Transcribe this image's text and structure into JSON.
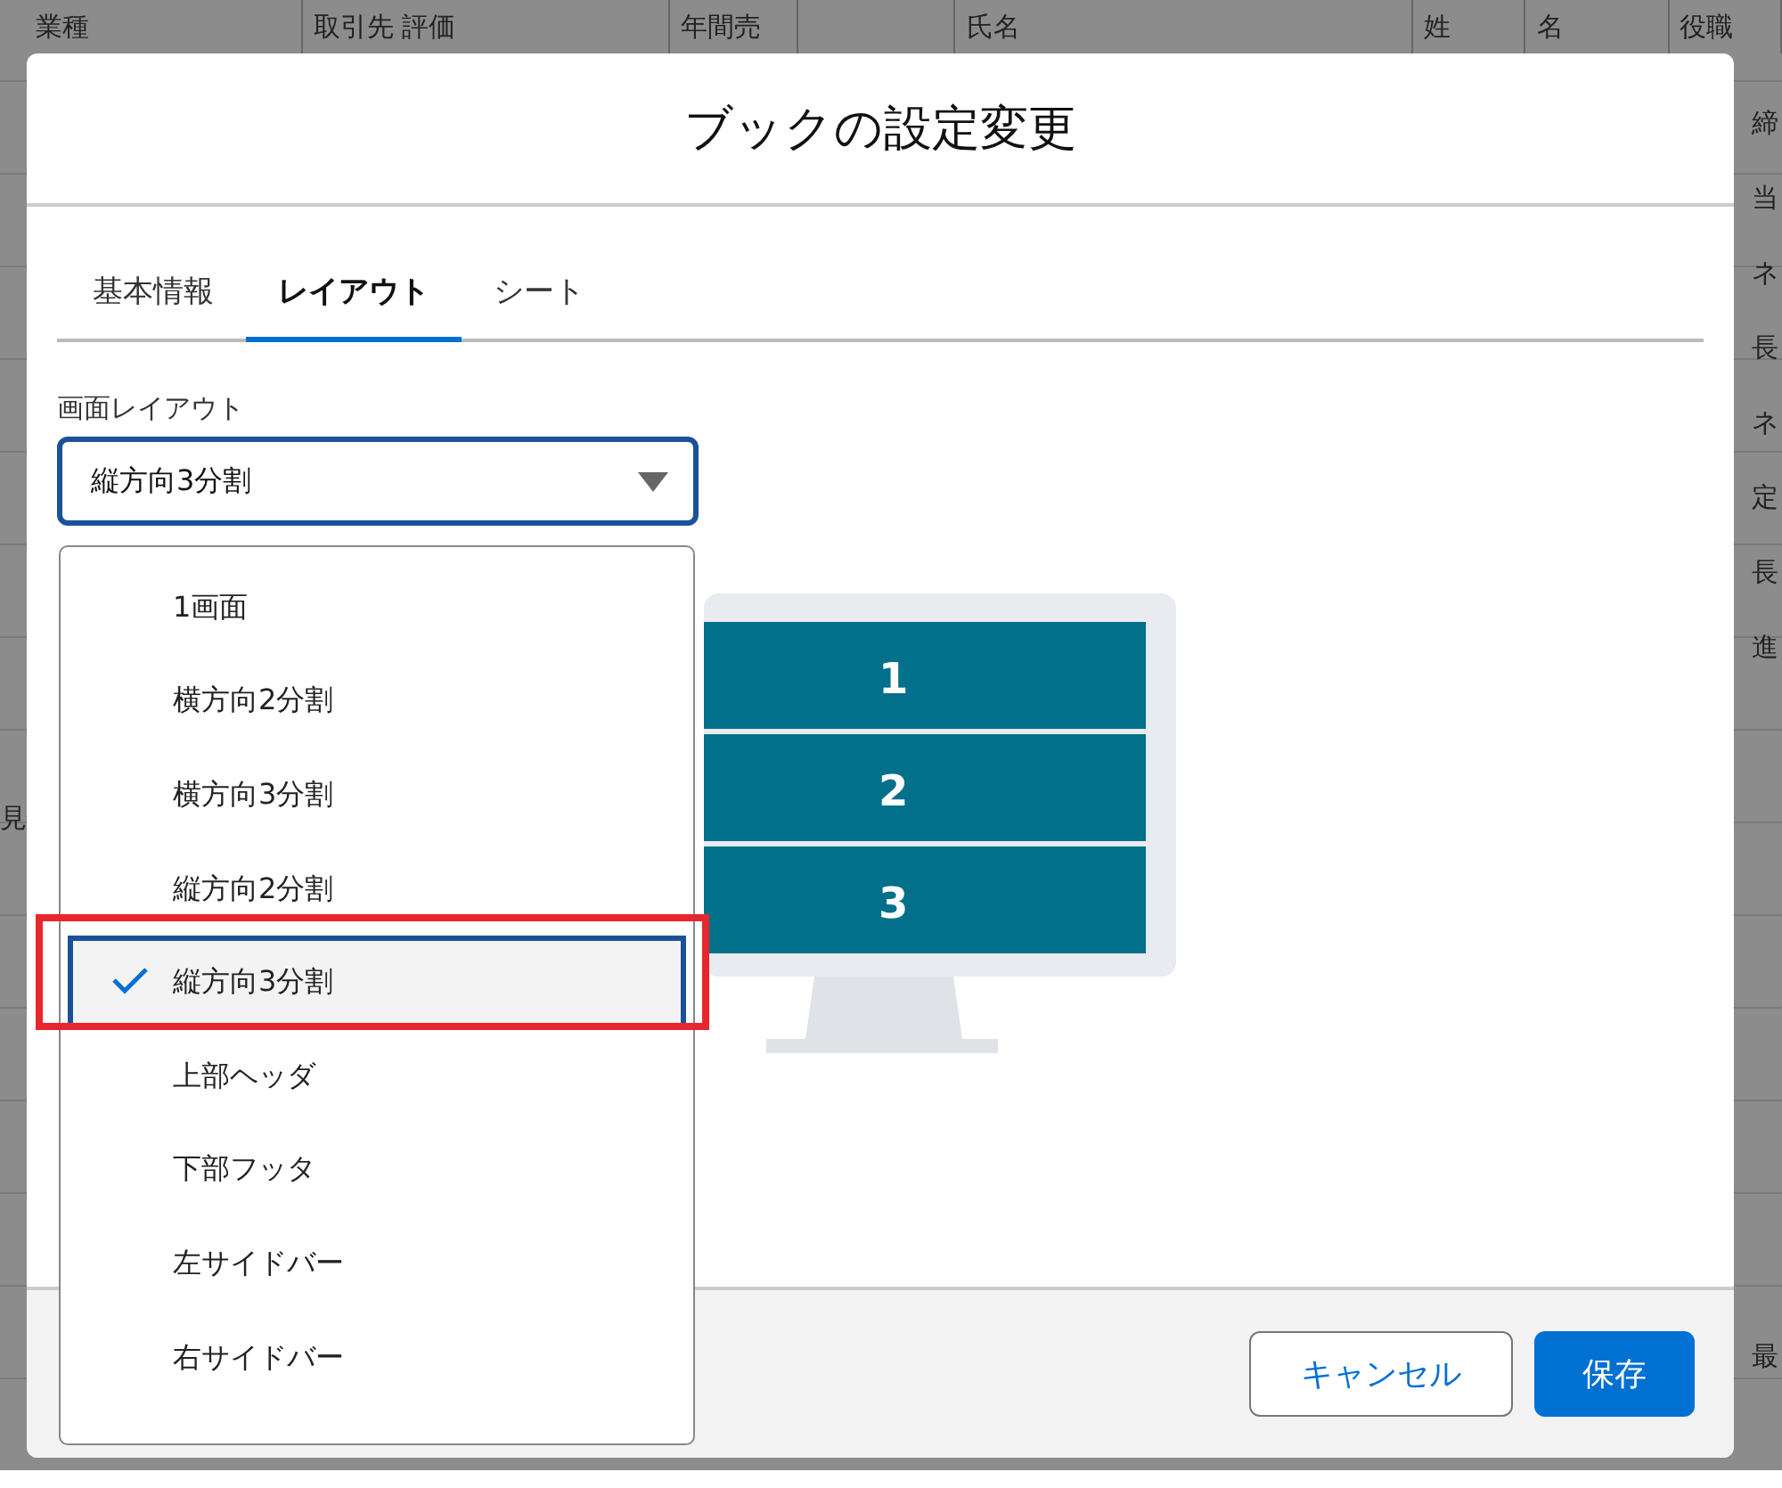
{
  "background_sheet": {
    "columns": [
      "業種",
      "取引先 評価",
      "年間売",
      "",
      "氏名",
      "姓",
      "名",
      "役職"
    ],
    "right_fragments": [
      "締",
      "当",
      "ネ",
      "長",
      "ネ",
      "定",
      "長",
      "進"
    ],
    "left_fragment": "見",
    "right_bottom": "最"
  },
  "dialog": {
    "title": "ブックの設定変更",
    "tabs": [
      {
        "label": "基本情報",
        "selected": false
      },
      {
        "label": "レイアウト",
        "selected": true
      },
      {
        "label": "シート",
        "selected": false
      }
    ],
    "layout_field": {
      "label": "画面レイアウト",
      "value": "縦方向3分割",
      "options": [
        {
          "label": "1画面",
          "selected": false,
          "annotated": false
        },
        {
          "label": "横方向2分割",
          "selected": false,
          "annotated": false
        },
        {
          "label": "横方向3分割",
          "selected": false,
          "annotated": false
        },
        {
          "label": "縦方向2分割",
          "selected": false,
          "annotated": false
        },
        {
          "label": "縦方向3分割",
          "selected": true,
          "annotated": true
        },
        {
          "label": "上部ヘッダ",
          "selected": false,
          "annotated": false
        },
        {
          "label": "下部フッタ",
          "selected": false,
          "annotated": false
        },
        {
          "label": "左サイドバー",
          "selected": false,
          "annotated": false
        },
        {
          "label": "右サイドバー",
          "selected": false,
          "annotated": false
        }
      ]
    },
    "preview_panes": [
      "1",
      "2",
      "3"
    ],
    "buttons": [
      {
        "label": "キャンセル",
        "kind": "neutral"
      },
      {
        "label": "保存",
        "kind": "brand"
      }
    ]
  }
}
